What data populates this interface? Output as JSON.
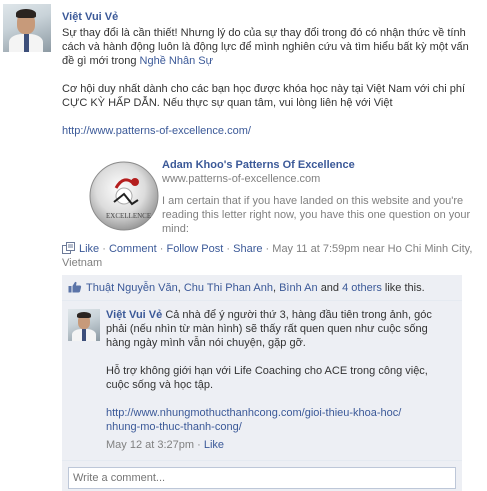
{
  "post": {
    "author": "Việt Vui Vẻ",
    "text_1_before": "Sự thay đổi là cần thiết! Nhưng lý do của sự thay đổi trong đó có nhận thức về tính cách và hành động luôn là động lực để mình nghiên cứu và tìm hiểu bất kỳ một vấn đề gì mới trong ",
    "text_1_link": "Nghề Nhân Sự",
    "text_2": "Cơ hội duy nhất dành cho các bạn học được khóa học này tại Việt Nam với chi phí CỰC KỲ HẤP DẪN. Nếu thực sự quan tâm, vui lòng liên hệ với Việt",
    "url": "http://www.patterns-of-excellence.com/",
    "attachment": {
      "title": "Adam Khoo's Patterns Of Excellence",
      "caption": "www.patterns-of-excellence.com",
      "description": "I am certain that if you have landed on this website and you're reading this letter right now, you have this one question on your mind:",
      "thumb_label": "EXCELLENCE"
    },
    "actions": {
      "like": "Like",
      "comment": "Comment",
      "follow": "Follow Post",
      "share": "Share",
      "timestamp": "May 11 at 7:59pm near Ho Chi Minh City, Vietnam"
    }
  },
  "likes": {
    "name1": "Thuật Nguyễn Văn",
    "name2": "Chu Thi Phan Anh",
    "name3": "Bình An",
    "and": "and",
    "others": "4 others",
    "suffix": "like this."
  },
  "comment": {
    "author": "Việt Vui Vẻ",
    "text_1": "Cả nhà để ý người thứ 3, hàng đầu tiên trong ảnh, góc phải (nếu nhìn từ màn hình) sẽ thấy rất quen quen như cuộc sống hàng ngày mình vẫn nói chuyện, gặp gỡ.",
    "text_2": "Hỗ trợ không giới hạn với Life Coaching cho ACE trong công việc, cuộc sống và học tập.",
    "url_line1": "http://www.nhungmothucthanhcong.com/gioi-thieu-khoa-hoc/",
    "url_line2": "nhung-mo-thuc-thanh-cong/",
    "timestamp": "May 12 at 3:27pm",
    "like": "Like"
  },
  "write_comment": {
    "placeholder": "Write a comment..."
  },
  "colors": {
    "link": "#3b5998",
    "ufi_bg": "#edeff4",
    "meta": "#808080"
  }
}
